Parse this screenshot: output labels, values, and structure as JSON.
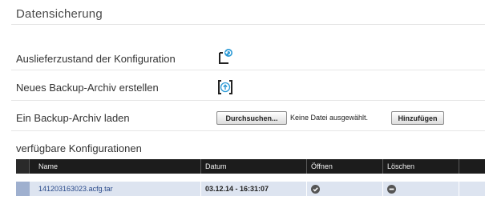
{
  "page": {
    "title": "Datensicherung"
  },
  "rows": {
    "factory_reset": {
      "label": "Auslieferzustand der Konfiguration",
      "icon": "factory-reset-icon"
    },
    "create_backup": {
      "label": "Neues Backup-Archiv erstellen",
      "icon": "create-backup-icon"
    },
    "load_backup": {
      "label": "Ein Backup-Archiv laden",
      "browse_label": "Durchsuchen...",
      "file_status": "Keine Datei ausgewählt.",
      "add_label": "Hinzufügen"
    }
  },
  "configurations": {
    "title": "verfügbare Konfigurationen",
    "columns": [
      "Name",
      "Datum",
      "Öffnen",
      "Löschen"
    ],
    "items": [
      {
        "name": "141203163023.acfg.tar",
        "date": "03.12.14 - 16:31:07",
        "open_icon": "check-circle-icon",
        "delete_icon": "minus-circle-icon"
      }
    ]
  },
  "colors": {
    "accent": "#2e9bd6",
    "table_header": "#1c1c1c",
    "row_highlight": "#dde4f0"
  }
}
